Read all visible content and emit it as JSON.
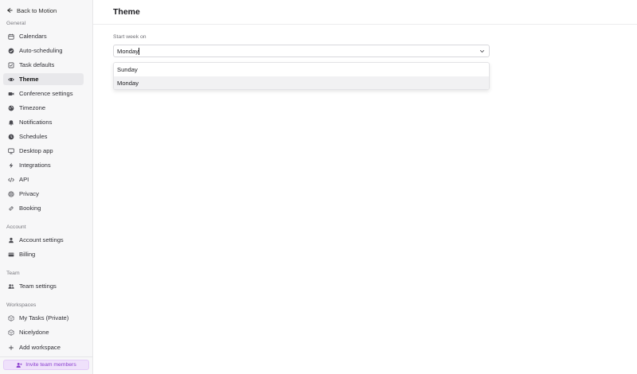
{
  "sidebar": {
    "back_label": "Back to Motion",
    "sections": {
      "general": "General",
      "account": "Account",
      "team": "Team",
      "workspaces": "Workspaces"
    },
    "general_items": [
      {
        "label": "Calendars",
        "icon": "calendar-icon"
      },
      {
        "label": "Auto-scheduling",
        "icon": "check-circle-icon"
      },
      {
        "label": "Task defaults",
        "icon": "task-icon"
      },
      {
        "label": "Theme",
        "icon": "eye-icon",
        "active": true
      },
      {
        "label": "Conference settings",
        "icon": "video-icon"
      },
      {
        "label": "Timezone",
        "icon": "globe-icon"
      },
      {
        "label": "Notifications",
        "icon": "bell-icon"
      },
      {
        "label": "Schedules",
        "icon": "clock-icon"
      },
      {
        "label": "Desktop app",
        "icon": "monitor-icon"
      },
      {
        "label": "Integrations",
        "icon": "bolt-icon"
      },
      {
        "label": "API",
        "icon": "code-icon"
      },
      {
        "label": "Privacy",
        "icon": "fingerprint-icon"
      },
      {
        "label": "Booking",
        "icon": "link-icon"
      }
    ],
    "account_items": [
      {
        "label": "Account settings",
        "icon": "user-icon"
      },
      {
        "label": "Billing",
        "icon": "card-icon"
      }
    ],
    "team_items": [
      {
        "label": "Team settings",
        "icon": "users-icon"
      }
    ],
    "workspace_items": [
      {
        "label": "My Tasks (Private)",
        "icon": "workspace-icon"
      },
      {
        "label": "Nicelydone",
        "icon": "workspace-icon"
      },
      {
        "label": "Add workspace",
        "icon": "plus-icon"
      }
    ],
    "invite_label": "Invite team members"
  },
  "main": {
    "title": "Theme",
    "start_week": {
      "label": "Start week on",
      "value": "Monday",
      "options": [
        "Sunday",
        "Monday"
      ],
      "selected": "Monday"
    }
  },
  "colors": {
    "sidebar_bg": "#f7f7f8",
    "active_bg": "#e8e8eb",
    "invite_accent": "#8b3fd0",
    "invite_bg": "#efe1fb"
  }
}
